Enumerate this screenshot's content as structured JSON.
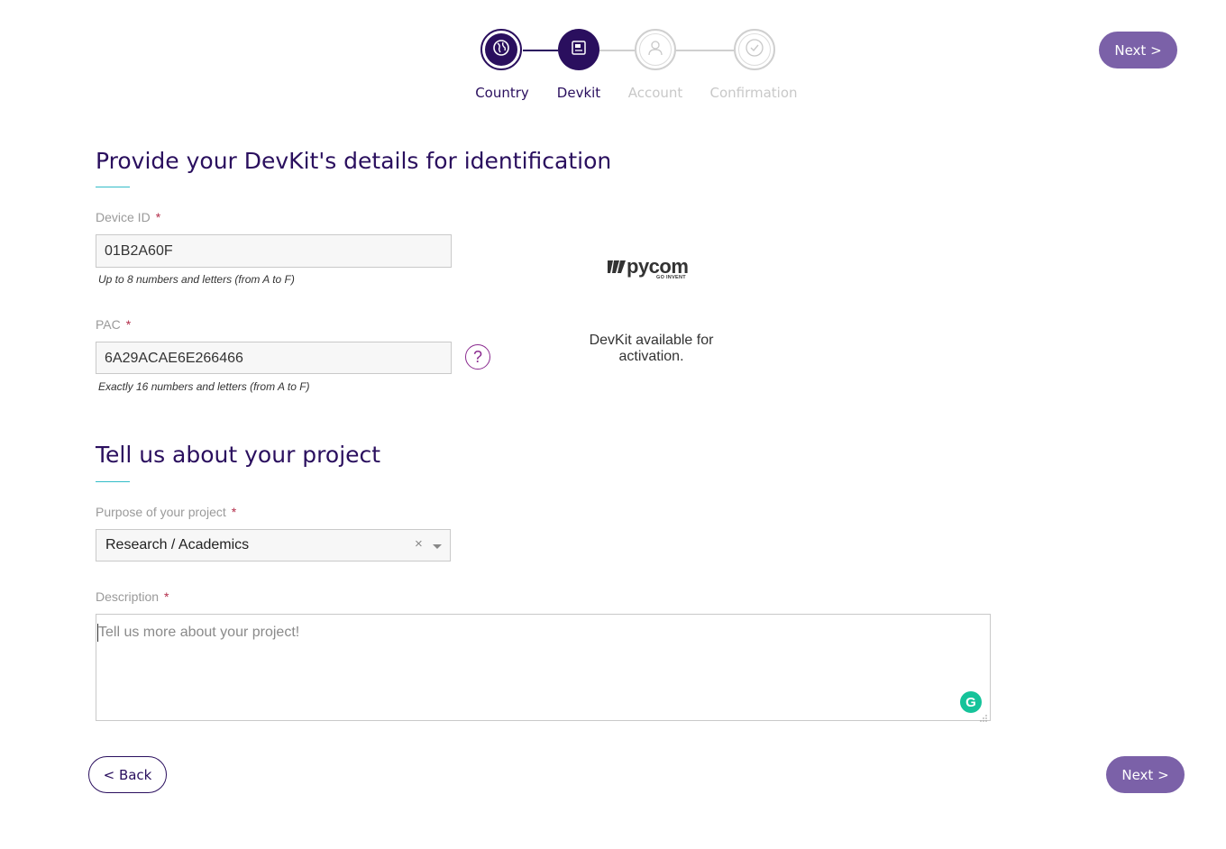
{
  "stepper": {
    "steps": [
      {
        "label": "Country",
        "icon": "globe-icon",
        "state": "done"
      },
      {
        "label": "Devkit",
        "icon": "devkit-icon",
        "state": "active"
      },
      {
        "label": "Account",
        "icon": "user-icon",
        "state": "todo"
      },
      {
        "label": "Confirmation",
        "icon": "check-icon",
        "state": "todo"
      }
    ]
  },
  "header": {
    "next_label": "Next >"
  },
  "devkit_section": {
    "title": "Provide your DevKit's details for identification",
    "device_id": {
      "label": "Device ID",
      "required_mark": "*",
      "value": "01B2A60F",
      "hint": "Up to 8 numbers and letters (from A to F)"
    },
    "pac": {
      "label": "PAC",
      "required_mark": "*",
      "value": "6A29ACAE6E266466",
      "hint": "Exactly 16 numbers and letters (from A to F)",
      "help_label": "?"
    },
    "device_panel": {
      "brand": "pycom",
      "tagline": "GO INVENT",
      "status": "DevKit available for activation."
    }
  },
  "project_section": {
    "title": "Tell us about your project",
    "purpose": {
      "label": "Purpose of your project",
      "required_mark": "*",
      "selected": "Research / Academics",
      "clear_label": "×"
    },
    "description": {
      "label": "Description",
      "required_mark": "*",
      "placeholder": "Tell us more about your project!"
    }
  },
  "footer": {
    "back_label": "< Back",
    "next_label": "Next >"
  },
  "colors": {
    "brand_dark": "#2a0f5e",
    "button_purple": "#7b61a8",
    "accent_teal": "#32bcc8",
    "required_red": "#b32d4a",
    "grammarly_green": "#15c39a"
  }
}
